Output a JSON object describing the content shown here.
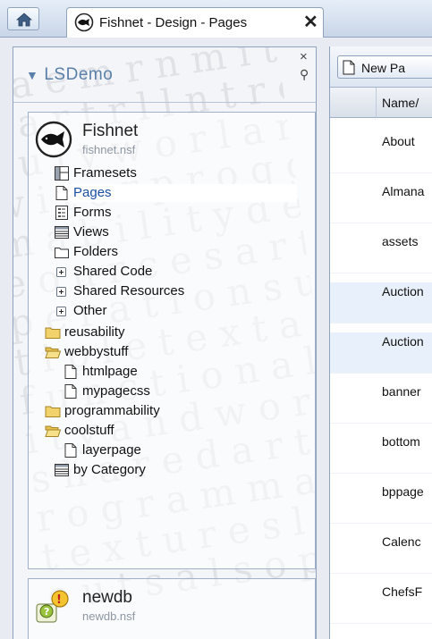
{
  "tabbar": {
    "tab_title": "Fishnet - Design - Pages",
    "close_symbol": "✕"
  },
  "navigator": {
    "title": "LSDemo",
    "close_symbol": "×",
    "databases": [
      {
        "name": "Fishnet",
        "file": "fishnet.nsf",
        "items": [
          {
            "label": "Framesets",
            "icon": "frameset-icon"
          },
          {
            "label": "Pages",
            "icon": "page-icon",
            "selected": true
          },
          {
            "label": "Forms",
            "icon": "form-icon"
          },
          {
            "label": "Views",
            "icon": "view-icon"
          },
          {
            "label": "Folders",
            "icon": "folder-outline-icon"
          },
          {
            "label": "Shared Code",
            "icon": "expand-icon"
          },
          {
            "label": "Shared Resources",
            "icon": "expand-icon"
          },
          {
            "label": "Other",
            "icon": "expand-icon"
          },
          {
            "label": "reusability",
            "icon": "folder-icon"
          },
          {
            "label": "webbystuff",
            "icon": "folder-open-icon"
          },
          {
            "label": "htmlpage",
            "icon": "page-icon"
          },
          {
            "label": "mypagecss",
            "icon": "page-icon"
          },
          {
            "label": "programmability",
            "icon": "folder-icon"
          },
          {
            "label": "coolstuff",
            "icon": "folder-open-icon"
          },
          {
            "label": "layerpage",
            "icon": "page-icon"
          },
          {
            "label": "by Category",
            "icon": "view-icon"
          }
        ]
      },
      {
        "name": "newdb",
        "file": "newdb.nsf"
      }
    ]
  },
  "right_panel": {
    "new_button_label": "New Pa",
    "column_header": "Name/",
    "rows": [
      "About",
      "Almana",
      "assets",
      "Auction",
      "Auction",
      "banner",
      "bottom",
      "bppage",
      "Calenc",
      "ChefsF"
    ]
  },
  "colors": {
    "accent": "#5a7fa8",
    "selected_text": "#1b4ea0",
    "border": "#8fa3bf"
  }
}
